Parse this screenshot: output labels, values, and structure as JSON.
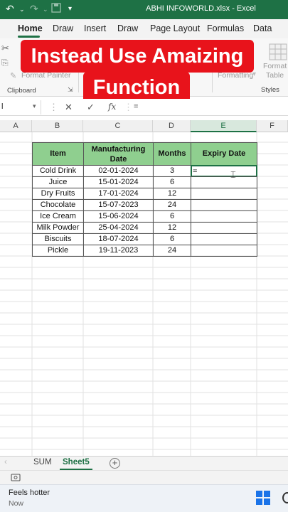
{
  "titlebar": {
    "filename": "ABHI INFOWORLD.xlsx",
    "app_name": "Excel",
    "separator": "-",
    "bg_color": "#1e7145"
  },
  "tabs": [
    "Home",
    "Draw",
    "Insert",
    "Draw",
    "Page Layout",
    "Formulas",
    "Data"
  ],
  "active_tab": "Home",
  "ribbon": {
    "format_painter": "Format Painter",
    "clipboard_group": "Clipboard",
    "formatting": "Formatting",
    "format_as": "Format A",
    "table": "Table",
    "styles_group": "Styles"
  },
  "banner": {
    "line1": "Instead Use Amaizing",
    "line2": "Function",
    "color": "#e8131b"
  },
  "formula_bar": {
    "fx_label": "fx",
    "value": "="
  },
  "columns": [
    "A",
    "B",
    "C",
    "D",
    "E",
    "F"
  ],
  "active_column": "E",
  "table": {
    "headers": [
      "Item",
      "Manufacturing Date",
      "Months",
      "Expiry Date"
    ],
    "header_color": "#8fcf8f",
    "rows": [
      [
        "Cold Drink",
        "02-01-2024",
        "3",
        "="
      ],
      [
        "Juice",
        "15-01-2024",
        "6",
        ""
      ],
      [
        "Dry Fruits",
        "17-01-2024",
        "12",
        ""
      ],
      [
        "Chocolate",
        "15-07-2023",
        "24",
        ""
      ],
      [
        "Ice Cream",
        "15-06-2024",
        "6",
        ""
      ],
      [
        "Milk Powder",
        "25-04-2024",
        "12",
        ""
      ],
      [
        "Biscuits",
        "18-07-2024",
        "6",
        ""
      ],
      [
        "Pickle",
        "19-11-2023",
        "24",
        ""
      ]
    ]
  },
  "sheets": [
    "SUM",
    "Sheet5"
  ],
  "active_sheet": "Sheet5",
  "taskbar": {
    "weather_title": "Feels hotter",
    "weather_sub": "Now"
  }
}
